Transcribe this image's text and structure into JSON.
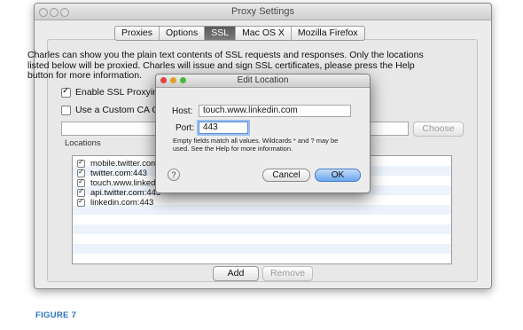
{
  "window": {
    "title": "Proxy Settings",
    "tabs": [
      {
        "label": "Proxies"
      },
      {
        "label": "Options"
      },
      {
        "label": "SSL"
      },
      {
        "label": "Mac OS X"
      },
      {
        "label": "Mozilla Firefox"
      }
    ],
    "selected_tab": "SSL"
  },
  "ssl": {
    "description": "Charles can show you the plain text contents of SSL requests and responses. Only the locations listed below will be proxied. Charles will issue and sign SSL certificates, please press the Help button for more information.",
    "enable_label": "Enable SSL Proxying",
    "enable_checked": true,
    "custom_ca_label": "Use a Custom CA Ce",
    "custom_ca_checked": false,
    "choose_label": "Choose",
    "locations_label": "Locations",
    "locations": [
      {
        "text": "mobile.twitter.com",
        "checked": true
      },
      {
        "text": "twitter.com:443",
        "checked": true
      },
      {
        "text": "touch.www.linked",
        "checked": true
      },
      {
        "text": "api.twitter.com:443",
        "checked": true
      },
      {
        "text": "linkedin.com:443",
        "checked": true
      }
    ],
    "add_label": "Add",
    "remove_label": "Remove"
  },
  "dialog": {
    "title": "Edit Location",
    "host_label": "Host:",
    "host_value": "touch.www.linkedin.com",
    "port_label": "Port:",
    "port_value": "443",
    "hint": "Empty fields match all values. Wildcards * and ? may be used. See the Help for more information.",
    "help_label": "?",
    "cancel_label": "Cancel",
    "ok_label": "OK"
  },
  "caption": "FIGURE 7",
  "colors": {
    "selected_tab": "#666666",
    "default_button": "#6aa6ee",
    "caption": "#2a73bd",
    "close_dot": "#e0443e",
    "min_dot": "#dea123",
    "zoom_dot": "#49b93a"
  }
}
